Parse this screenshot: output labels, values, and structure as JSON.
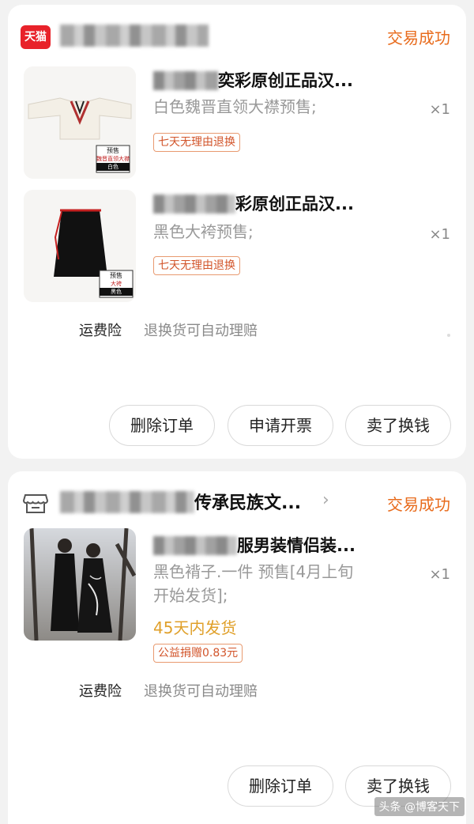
{
  "orders": [
    {
      "shop_logo": "天猫",
      "status": "交易成功",
      "items": [
        {
          "title": "奕彩原创正品汉...",
          "spec": "白色魏晋直领大襟预售;",
          "quantity": "×1",
          "tag": "七天无理由退换",
          "thumb_label_1": "预售",
          "thumb_label_2": "魏晋直领大襟",
          "thumb_label_3": "白色"
        },
        {
          "title": "彩原创正品汉...",
          "spec": "黑色大袴预售;",
          "quantity": "×1",
          "tag": "七天无理由退换",
          "thumb_label_1": "预售",
          "thumb_label_2": "大袴",
          "thumb_label_3": "黑色"
        }
      ],
      "insurance_label": "运费险",
      "insurance_value": "退换货可自动理赔",
      "buttons": [
        "删除订单",
        "申请开票",
        "卖了换钱"
      ]
    },
    {
      "shop_name_tail": "传承民族文...",
      "status": "交易成功",
      "items": [
        {
          "title": "服男装情侣装...",
          "spec_line1": "黑色褙子.一件 预售[4月上旬",
          "spec_line2": "开始发货];",
          "quantity": "×1",
          "shipping": "45天内发货",
          "tag": "公益捐赠0.83元"
        }
      ],
      "insurance_label": "运费险",
      "insurance_value": "退换货可自动理赔",
      "buttons": [
        "删除订单",
        "卖了换钱"
      ]
    }
  ],
  "watermark": "头条 @博客天下",
  "colors": {
    "status": "#e86b1c",
    "tmall_red": "#e8222a",
    "tag": "#d2542a",
    "shipping": "#e0a02a"
  },
  "icons": [
    "tmall-logo",
    "store-icon",
    "chevron-right-icon"
  ]
}
